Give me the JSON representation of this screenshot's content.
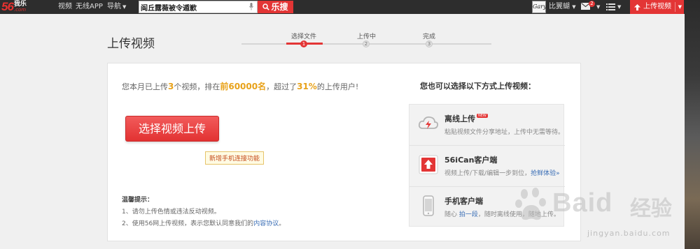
{
  "topbar": {
    "logo_num": "56",
    "logo_cn": "我乐",
    "logo_com": ".com",
    "nav": [
      {
        "label": "视频"
      },
      {
        "label": "无线APP"
      },
      {
        "label": "导航"
      }
    ],
    "search_value": "阎丘露薇被令遁歉",
    "search_button": "乐搜",
    "avatar_text": "Gary",
    "username": "比翼蝴",
    "mail_badge": "2",
    "upload_button": "上传视频",
    "colors": {
      "bar": "#2d2d2d",
      "accent": "#e33535"
    }
  },
  "page": {
    "title": "上传视频",
    "steps": [
      {
        "label": "选择文件",
        "num": "1"
      },
      {
        "label": "上传中",
        "num": "2"
      },
      {
        "label": "完成",
        "num": "3"
      }
    ],
    "active_step": 1
  },
  "panel": {
    "stats": {
      "p1": "您本月已上传",
      "count": "3",
      "p2": "个视频，排在",
      "rank": "前60000名",
      "p3": "，超过了",
      "percent": "31%",
      "p4": "的上传用户!"
    },
    "main_button": "选择视频上传",
    "tips_title": "温馨提示：",
    "tips": [
      {
        "text": "1、请勿上传色情或违法反动视频。"
      },
      {
        "text": "2、使用56网上传视频，表示您默认同意我们的",
        "link": "内容协议",
        "end": "。"
      }
    ],
    "alt_title": "您也可以选择以下方式上传视频：",
    "alt_methods": [
      {
        "name": "离线上传",
        "badge": "NEW",
        "desc": "粘贴视频文件分享地址，上传中无需等待。",
        "icon": "cloud-lightning-icon"
      },
      {
        "name": "56iCan客户端",
        "desc": "视频上传/下载/编辑一步到位，",
        "link": "抢鲜体验»",
        "icon": "upload-arrow-icon"
      },
      {
        "name": "手机客户端",
        "desc_pre": "随心",
        "link": "拍一段",
        "desc_post": "，随时离线使用，随地上传。",
        "icon": "mobile-phone-icon"
      }
    ],
    "tooltip": "新增手机连接功能"
  },
  "watermark": {
    "text": "Baid",
    "cn": "经验",
    "url": "jingyan.baidu.com"
  }
}
